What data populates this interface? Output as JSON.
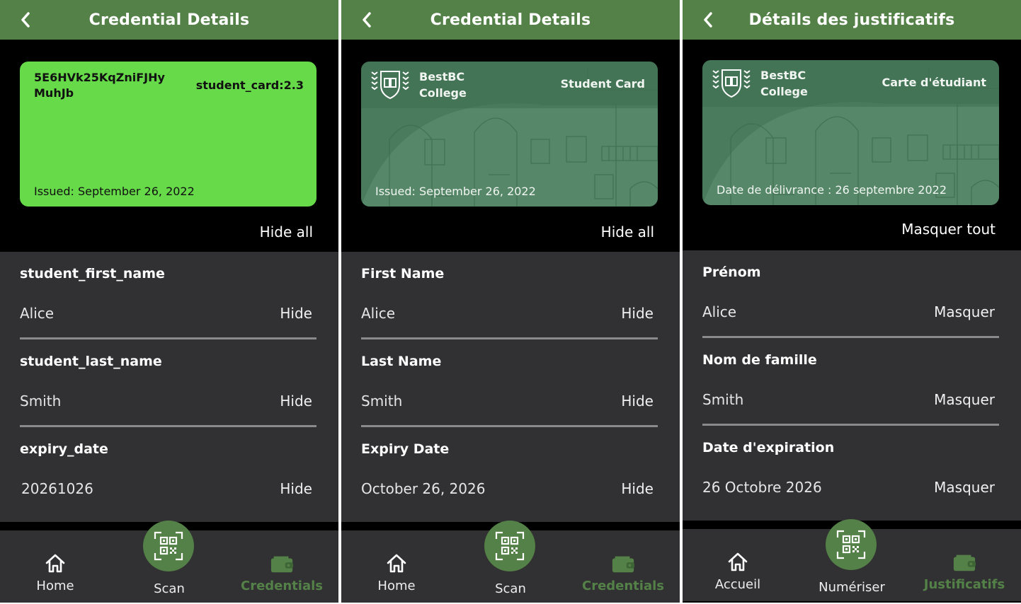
{
  "colors": {
    "header": "#548147",
    "accent": "#548147",
    "raw_card": "#66da49",
    "branded_card": "#4a7b5c",
    "attributes_bg": "#313133",
    "page_bg": "#000000"
  },
  "panels": [
    {
      "header": {
        "title": "Credential Details",
        "back_icon": "chevron-left-icon"
      },
      "card": {
        "variant": "raw",
        "connection_id": "5E6HVk25KqZniFJHy MuhJb",
        "schema": "student_card:2.3",
        "issued": "Issued: September 26, 2022"
      },
      "hide_all_label": "Hide all",
      "attributes": [
        {
          "name": "student_first_name",
          "value": "Alice",
          "action": "Hide"
        },
        {
          "name": "student_last_name",
          "value": "Smith",
          "action": "Hide"
        },
        {
          "name": "expiry_date",
          "value": "20261026",
          "action": "Hide"
        }
      ],
      "nav": {
        "home": "Home",
        "scan": "Scan",
        "credentials": "Credentials",
        "active": "credentials"
      }
    },
    {
      "header": {
        "title": "Credential Details",
        "back_icon": "chevron-left-icon"
      },
      "card": {
        "variant": "branded",
        "org_line1": "BestBC",
        "org_line2": "College",
        "type_label": "Student Card",
        "issued": "Issued: September 26, 2022"
      },
      "hide_all_label": "Hide all",
      "attributes": [
        {
          "name": "First Name",
          "value": "Alice",
          "action": "Hide"
        },
        {
          "name": "Last Name",
          "value": "Smith",
          "action": "Hide"
        },
        {
          "name": "Expiry Date",
          "value": "October 26, 2026",
          "action": "Hide"
        }
      ],
      "nav": {
        "home": "Home",
        "scan": "Scan",
        "credentials": "Credentials",
        "active": "credentials"
      }
    },
    {
      "header": {
        "title": "Détails des justificatifs",
        "back_icon": "chevron-left-icon"
      },
      "card": {
        "variant": "branded",
        "org_line1": "BestBC",
        "org_line2": "College",
        "type_label": "Carte d'étudiant",
        "issued": "Date de délivrance : 26 septembre 2022"
      },
      "hide_all_label": "Masquer tout",
      "attributes": [
        {
          "name": "Prénom",
          "value": "Alice",
          "action": "Masquer"
        },
        {
          "name": "Nom de famille",
          "value": "Smith",
          "action": "Masquer"
        },
        {
          "name": "Date d'expiration",
          "value": "26 Octobre 2026",
          "action": "Masquer"
        }
      ],
      "nav": {
        "home": "Accueil",
        "scan": "Numériser",
        "credentials": "Justificatifs",
        "active": "credentials"
      }
    }
  ]
}
